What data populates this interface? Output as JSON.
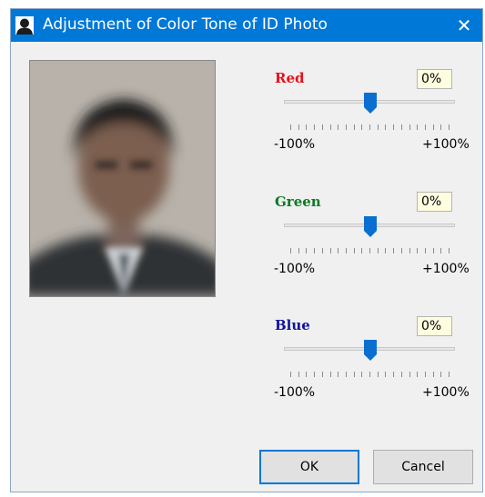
{
  "window": {
    "title": "Adjustment of Color Tone of ID Photo",
    "close_glyph": "✕",
    "icon": "user-silhouette-icon"
  },
  "photo": {
    "description_icon": "portrait-photo",
    "background_color": "#b6b0a8"
  },
  "controls": [
    {
      "key": "red",
      "label": "Red",
      "color": "#e8101c",
      "value": "0%",
      "level_percent": 0,
      "min_label": "-100%",
      "max_label": "+100%"
    },
    {
      "key": "green",
      "label": "Green",
      "color": "#0c7a24",
      "value": "0%",
      "level_percent": 0,
      "min_label": "-100%",
      "max_label": "+100%"
    },
    {
      "key": "blue",
      "label": "Blue",
      "color": "#10149a",
      "value": "0%",
      "level_percent": 0,
      "min_label": "-100%",
      "max_label": "+100%"
    }
  ],
  "buttons": {
    "ok_label": "OK",
    "cancel_label": "Cancel"
  },
  "colors": {
    "titlebar": "#0078d7",
    "slider_thumb": "#0a6fd0",
    "default_button_border": "#0078d7"
  }
}
